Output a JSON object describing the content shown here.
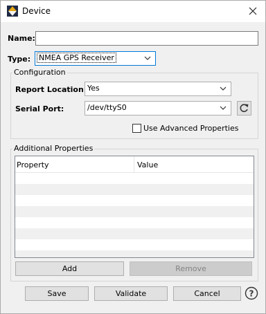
{
  "window": {
    "title": "Device"
  },
  "form": {
    "name_label": "Name:",
    "name_value": "",
    "type_label": "Type:",
    "type_value": "NMEA GPS Receiver"
  },
  "configuration": {
    "group_title": "Configuration",
    "report_location_label": "Report Location:",
    "report_location_value": "Yes",
    "serial_port_label": "Serial Port:",
    "serial_port_value": "/dev/ttyS0",
    "advanced_checkbox_label": "Use Advanced Properties",
    "advanced_checked": false
  },
  "additional": {
    "group_title": "Additional Properties",
    "columns": [
      "Property",
      "Value"
    ],
    "rows": [],
    "add_label": "Add",
    "remove_label": "Remove"
  },
  "footer": {
    "save_label": "Save",
    "validate_label": "Validate",
    "cancel_label": "Cancel"
  },
  "icons": {
    "app": "app-logo-icon",
    "close": "close-icon",
    "refresh": "refresh-icon",
    "chevron": "chevron-down-icon",
    "help": "help-icon"
  },
  "colors": {
    "window_bg": "#f0f0f0",
    "button_bg": "#e1e1e1",
    "disabled_button_bg": "#cccccc",
    "row_stripe": "#f0f0f0",
    "logo_dark": "#1f2a44",
    "logo_gold": "#e6a817"
  }
}
